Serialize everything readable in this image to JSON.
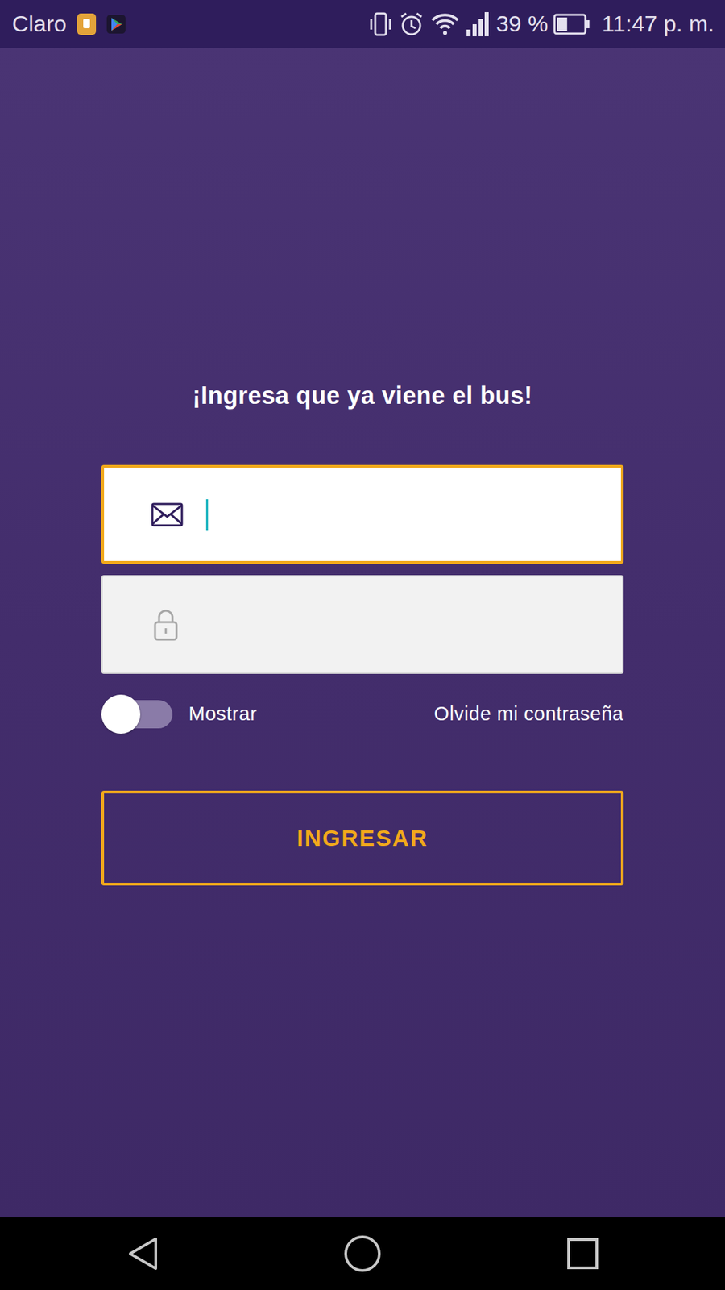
{
  "status_bar": {
    "carrier": "Claro",
    "battery": "39 %",
    "battery_level": 0.39,
    "time": "11:47 p. m."
  },
  "title": "¡Ingresa que ya viene el bus!",
  "fields": [
    {
      "kind": "email",
      "value": "",
      "focused": true
    },
    {
      "kind": "password",
      "value": "",
      "focused": false
    }
  ],
  "show_password": {
    "label": "Mostrar",
    "on": false
  },
  "forgot_link": "Olvide mi contraseña",
  "submit": "INGRESAR"
}
